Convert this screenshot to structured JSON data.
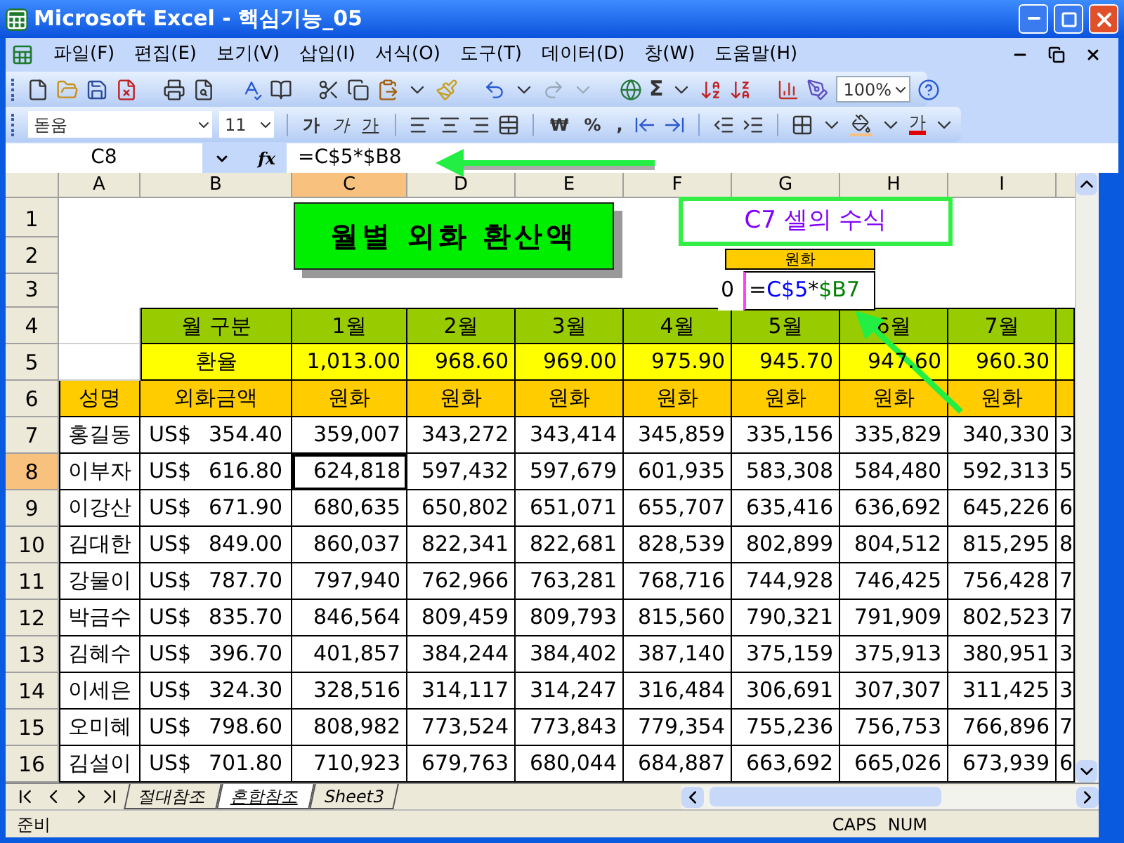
{
  "window": {
    "title": "Microsoft Excel - 핵심기능_05"
  },
  "menu": [
    "파일(F)",
    "편집(E)",
    "보기(V)",
    "삽입(I)",
    "서식(O)",
    "도구(T)",
    "데이터(D)",
    "창(W)",
    "도움말(H)"
  ],
  "standard_toolbar": {
    "sum_symbol": "Σ",
    "zoom": "100%"
  },
  "formatting_toolbar": {
    "font": "돋움",
    "size": "11",
    "style_buttons": [
      {
        "label": "가",
        "kind": "bold"
      },
      {
        "label": "가",
        "kind": "italic"
      },
      {
        "label": "가",
        "kind": "underline"
      }
    ],
    "number_buttons": [
      "₩",
      "%",
      ","
    ],
    "font_color_label": "가"
  },
  "formula_bar": {
    "cell": "C8",
    "function_label": "fx",
    "formula": "=C$5*$B8"
  },
  "columns": [
    {
      "label": "A",
      "selected": false
    },
    {
      "label": "B",
      "selected": false
    },
    {
      "label": "C",
      "selected": true
    },
    {
      "label": "D",
      "selected": false
    },
    {
      "label": "E",
      "selected": false
    },
    {
      "label": "F",
      "selected": false
    },
    {
      "label": "G",
      "selected": false
    },
    {
      "label": "H",
      "selected": false
    },
    {
      "label": "I",
      "selected": false
    }
  ],
  "empty_rows": [
    {
      "header": "1",
      "selected": false
    },
    {
      "header": "2",
      "selected": false
    },
    {
      "header": "3",
      "selected": false
    }
  ],
  "month_row": {
    "header": "4",
    "selected": false,
    "label": "월 구분",
    "months": [
      "1월",
      "2월",
      "3월",
      "4월",
      "5월",
      "6월",
      "7월"
    ]
  },
  "rate_row": {
    "header": "5",
    "selected": false,
    "label": "환율",
    "rates": [
      "1,013.00",
      "968.60",
      "969.00",
      "975.90",
      "945.70",
      "947.60",
      "960.30"
    ]
  },
  "heading_row": {
    "header": "6",
    "selected": false,
    "name": "성명",
    "amount": "외화금액",
    "columns": [
      "원화",
      "원화",
      "원화",
      "원화",
      "원화",
      "원화",
      "원화"
    ]
  },
  "rows": [
    {
      "header": "7",
      "selected": false,
      "name": "홍길동",
      "currency": "US$",
      "amount": "354.40",
      "values": [
        "359,007",
        "343,272",
        "343,414",
        "345,859",
        "335,156",
        "335,829",
        "340,330"
      ],
      "cut": "3"
    },
    {
      "header": "8",
      "selected": true,
      "name": "이부자",
      "currency": "US$",
      "amount": "616.80",
      "values": [
        "624,818",
        "597,432",
        "597,679",
        "601,935",
        "583,308",
        "584,480",
        "592,313"
      ],
      "cut": "5"
    },
    {
      "header": "9",
      "selected": false,
      "name": "이강산",
      "currency": "US$",
      "amount": "671.90",
      "values": [
        "680,635",
        "650,802",
        "651,071",
        "655,707",
        "635,416",
        "636,692",
        "645,226"
      ],
      "cut": "6"
    },
    {
      "header": "10",
      "selected": false,
      "name": "김대한",
      "currency": "US$",
      "amount": "849.00",
      "values": [
        "860,037",
        "822,341",
        "822,681",
        "828,539",
        "802,899",
        "804,512",
        "815,295"
      ],
      "cut": "8"
    },
    {
      "header": "11",
      "selected": false,
      "name": "강물이",
      "currency": "US$",
      "amount": "787.70",
      "values": [
        "797,940",
        "762,966",
        "763,281",
        "768,716",
        "744,928",
        "746,425",
        "756,428"
      ],
      "cut": "7"
    },
    {
      "header": "12",
      "selected": false,
      "name": "박금수",
      "currency": "US$",
      "amount": "835.70",
      "values": [
        "846,564",
        "809,459",
        "809,793",
        "815,560",
        "790,321",
        "791,909",
        "802,523"
      ],
      "cut": "7"
    },
    {
      "header": "13",
      "selected": false,
      "name": "김혜수",
      "currency": "US$",
      "amount": "396.70",
      "values": [
        "401,857",
        "384,244",
        "384,402",
        "387,140",
        "375,159",
        "375,913",
        "380,951"
      ],
      "cut": "3"
    },
    {
      "header": "14",
      "selected": false,
      "name": "이세은",
      "currency": "US$",
      "amount": "324.30",
      "values": [
        "328,516",
        "314,117",
        "314,247",
        "316,484",
        "306,691",
        "307,307",
        "311,425"
      ],
      "cut": "3"
    },
    {
      "header": "15",
      "selected": false,
      "name": "오미혜",
      "currency": "US$",
      "amount": "798.60",
      "values": [
        "808,982",
        "773,524",
        "773,843",
        "779,354",
        "755,236",
        "756,753",
        "766,896"
      ],
      "cut": "7"
    },
    {
      "header": "16",
      "selected": false,
      "name": "김설이",
      "currency": "US$",
      "amount": "701.80",
      "values": [
        "710,923",
        "679,763",
        "680,044",
        "684,887",
        "663,692",
        "665,026",
        "673,939"
      ],
      "cut": "6"
    }
  ],
  "title_box": {
    "text": "월별 외화 환산액"
  },
  "callout": {
    "text": "C7 셀의 수식"
  },
  "inset": {
    "header": "원화",
    "cut_value": "0",
    "formula_parts": [
      {
        "text": "=",
        "color": "#000000"
      },
      {
        "text": "C$5",
        "color": "#0000ff"
      },
      {
        "text": "*",
        "color": "#000000"
      },
      {
        "text": "$B7",
        "color": "#008000"
      }
    ]
  },
  "sheet_tabs": [
    {
      "label": "절대참조",
      "selected": false
    },
    {
      "label": "혼합참조",
      "selected": true
    },
    {
      "label": "Sheet3",
      "selected": false
    }
  ],
  "status_bar": {
    "status": "준비",
    "indicators": [
      "CAPS",
      "NUM"
    ]
  }
}
